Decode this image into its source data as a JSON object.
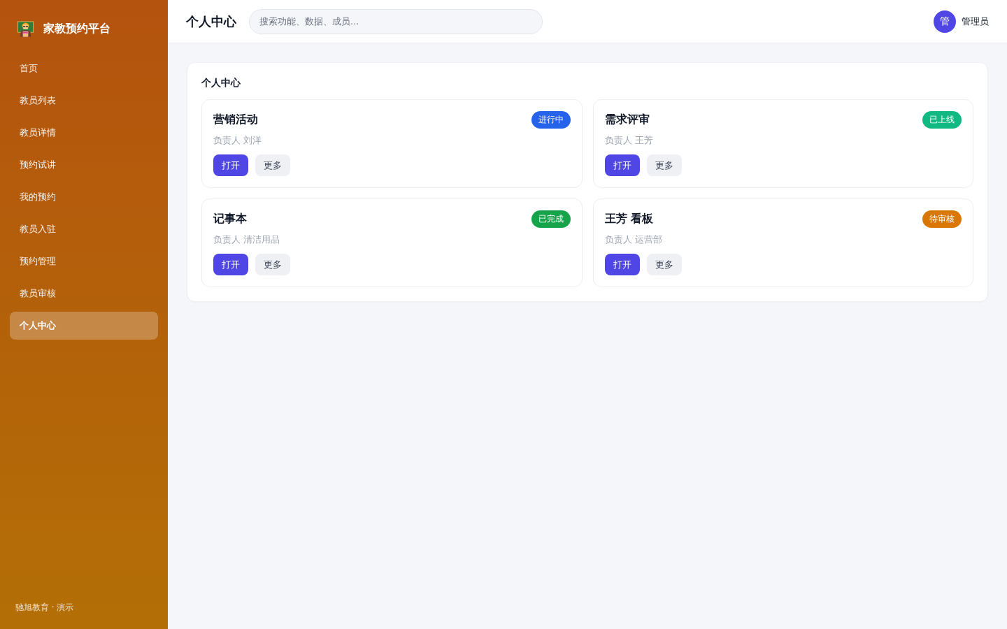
{
  "sidebar": {
    "brand": "家教预约平台",
    "items": [
      {
        "label": "首页",
        "selected": false
      },
      {
        "label": "教员列表",
        "selected": false
      },
      {
        "label": "教员详情",
        "selected": false
      },
      {
        "label": "预约试讲",
        "selected": false
      },
      {
        "label": "我的预约",
        "selected": false
      },
      {
        "label": "教员入驻",
        "selected": false
      },
      {
        "label": "预约管理",
        "selected": false
      },
      {
        "label": "教员审核",
        "selected": false
      },
      {
        "label": "个人中心",
        "selected": true
      }
    ],
    "footer": "驰旭教育 · 演示"
  },
  "header": {
    "title": "个人中心",
    "search": {
      "placeholder": "搜索功能、数据、成员..."
    },
    "user": {
      "avatar": "管",
      "name": "管理员"
    }
  },
  "panel": {
    "title": "个人中心",
    "cards": [
      {
        "title": "营销活动",
        "status": "进行中",
        "color": "#2563eb",
        "owner": "负责人 刘洋",
        "buttons": [
          {
            "label": "打开",
            "kind": "primary"
          },
          {
            "label": "更多",
            "kind": "secondary"
          }
        ]
      },
      {
        "title": "需求评审",
        "status": "已上线",
        "color": "#10b981",
        "owner": "负责人 王芳",
        "buttons": [
          {
            "label": "打开",
            "kind": "primary"
          },
          {
            "label": "更多",
            "kind": "secondary"
          }
        ]
      },
      {
        "title": "记事本",
        "status": "已完成",
        "color": "#16a34a",
        "owner": "负责人 清洁用品",
        "buttons": [
          {
            "label": "打开",
            "kind": "primary"
          },
          {
            "label": "更多",
            "kind": "secondary"
          }
        ]
      },
      {
        "title": "王芳 看板",
        "status": "待审核",
        "color": "#d97706",
        "owner": "负责人 运营部",
        "buttons": [
          {
            "label": "打开",
            "kind": "primary"
          },
          {
            "label": "更多",
            "kind": "secondary"
          }
        ]
      }
    ]
  }
}
